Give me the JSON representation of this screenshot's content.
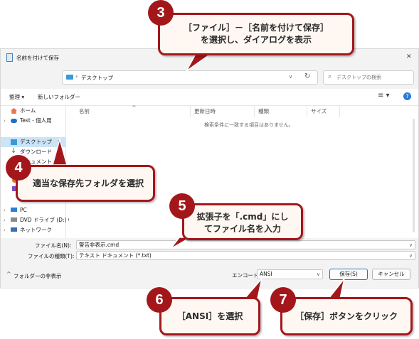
{
  "dialog": {
    "title": "名前を付けて保存",
    "close": "✕",
    "address_path": "デスクトップ",
    "search_placeholder": "デスクトップの検索",
    "toolbar": {
      "organize": "整理 ▾",
      "new_folder": "新しいフォルダー"
    },
    "sidebar": {
      "items": [
        {
          "label": "ホーム"
        },
        {
          "label": "Test - 個人用"
        },
        {
          "label": "デスクトップ",
          "selected": true
        },
        {
          "label": "ダウンロード"
        },
        {
          "label": "ドキュメント"
        },
        {
          "label": "PC"
        },
        {
          "label": "DVD ドライブ (D:) C"
        },
        {
          "label": "ネットワーク"
        }
      ]
    },
    "columns": [
      "名前",
      "更新日時",
      "種類",
      "サイズ"
    ],
    "empty_message": "検索条件に一致する項目はありません。",
    "filename_label": "ファイル名(N):",
    "filename_value": "警告非表示.cmd",
    "filetype_label": "ファイルの種類(T):",
    "filetype_value": "テキスト ドキュメント (*.txt)",
    "hide_folders": "フォルダーの非表示",
    "encoding_label": "エンコード:",
    "encoding_value": "ANSI",
    "save": "保存(S)",
    "cancel": "キャンセル"
  },
  "callouts": [
    {
      "number": "3",
      "line1": "［ファイル］－［名前を付けて保存］",
      "line2": "を選択し、ダイアログを表示"
    },
    {
      "number": "4",
      "line1": "適当な保存先フォルダを選択"
    },
    {
      "number": "5",
      "line1": "拡張子を「.cmd」にし",
      "line2": "てファイル名を入力"
    },
    {
      "number": "6",
      "line1": "［ANSI］を選択"
    },
    {
      "number": "7",
      "line1": "［保存］ボタンをクリック"
    }
  ],
  "colors": {
    "accent": "#a3171b",
    "callout_bg": "#fff8f2",
    "selection": "#cce4f7"
  }
}
